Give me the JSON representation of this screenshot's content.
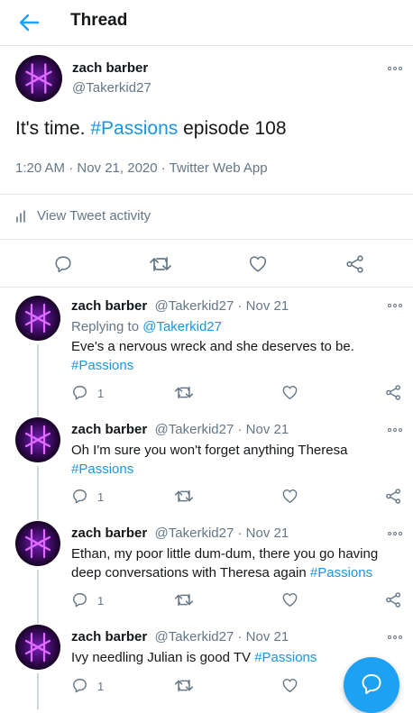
{
  "header": {
    "title": "Thread"
  },
  "main_tweet": {
    "name": "zach barber",
    "handle": "@Takerkid27",
    "text": "It's time. ",
    "hashtag": "#Passions",
    "text_after": " episode 108",
    "meta": "1:20 AM · Nov 21, 2020 · Twitter Web App",
    "activity_label": "View Tweet activity"
  },
  "replies": [
    {
      "name": "zach barber",
      "handle": "@Takerkid27 · Nov 21",
      "replying_prefix": "Replying to ",
      "replying_handle": "@Takerkid27",
      "text": "Eve's a nervous wreck and she deserves to be.",
      "hashtag": "#Passions",
      "reply_count": "1"
    },
    {
      "name": "zach barber",
      "handle": "@Takerkid27 · Nov 21",
      "text": "Oh I'm sure you won't forget anything Theresa",
      "hashtag": "#Passions",
      "reply_count": "1"
    },
    {
      "name": "zach barber",
      "handle": "@Takerkid27 · Nov 21",
      "text": "Ethan, my poor little dum-dum, there you go having deep conversations with Theresa again ",
      "hashtag": "#Passions",
      "reply_count": "1"
    },
    {
      "name": "zach barber",
      "handle": "@Takerkid27 · Nov 21",
      "text": "Ivy needling Julian is good TV ",
      "hashtag": "#Passions",
      "reply_count": "1"
    }
  ],
  "icons": {
    "back": "arrow-left-icon",
    "more": "more-dots-icon",
    "reply": "comment-icon",
    "retweet": "retweet-icon",
    "like": "heart-icon",
    "share": "share-icon",
    "activity": "bar-chart-icon",
    "compose": "chat-bubble-icon"
  },
  "colors": {
    "accent": "#1da1f2",
    "link": "#1b95e0",
    "secondary": "#657786",
    "border": "#e1e8ed"
  }
}
